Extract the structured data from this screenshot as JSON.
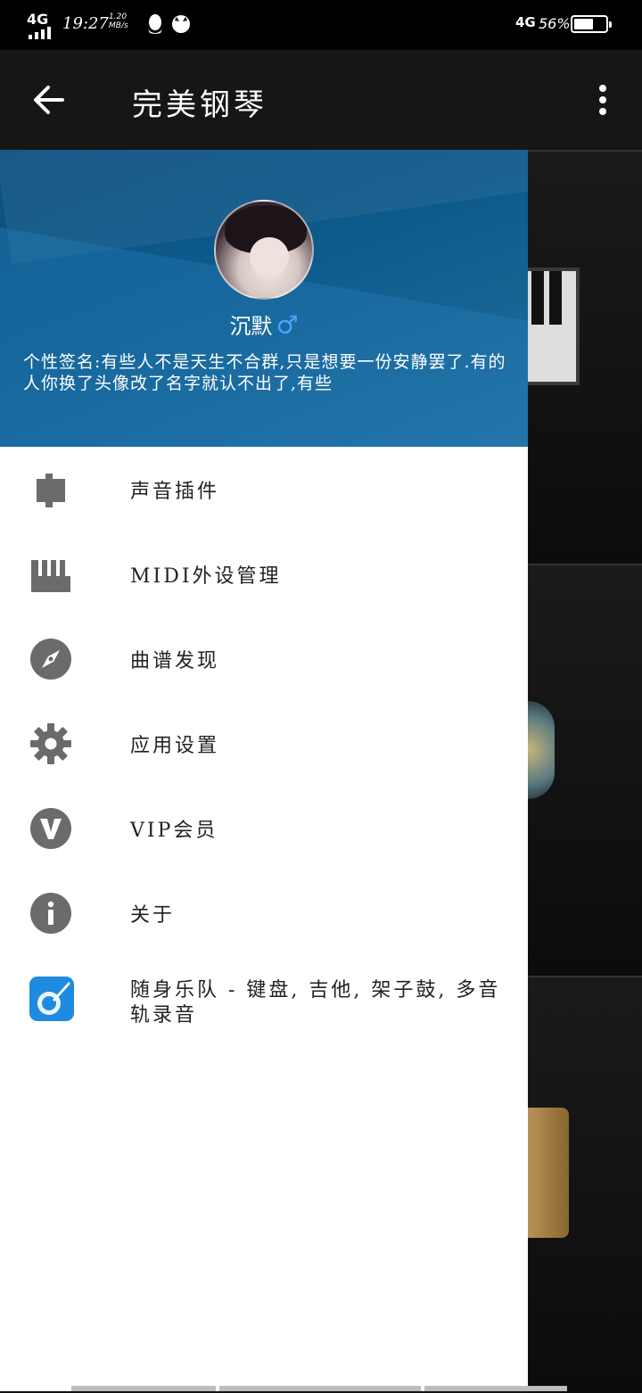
{
  "status_bar": {
    "network_left": "4G",
    "time": "19:27",
    "speed_value": "1.20",
    "speed_unit": "MB/s",
    "network_right": "4G",
    "battery_percent": "56%",
    "battery_level": 0.56
  },
  "app_bar": {
    "title": "完美钢琴"
  },
  "drawer": {
    "username": "沉默",
    "gender_symbol": "♂",
    "signature": "个性签名:有些人不是天生不合群,只是想要一份安静罢了.有的人你换了头像改了名字就认不出了,有些",
    "menu": [
      {
        "label": "声音插件",
        "icon": "puzzle-plugin-icon"
      },
      {
        "label": "MIDI外设管理",
        "icon": "piano-keys-icon"
      },
      {
        "label": "曲谱发现",
        "icon": "compass-icon"
      },
      {
        "label": "应用设置",
        "icon": "gear-icon"
      },
      {
        "label": "VIP会员",
        "icon": "vip-badge-icon"
      },
      {
        "label": "关于",
        "icon": "info-icon"
      },
      {
        "label": "随身乐队 - 键盘, 吉他, 架子鼓, 多音轨录音",
        "icon": "band-app-icon"
      }
    ]
  },
  "colors": {
    "header_blue": "#0d5a8c",
    "icon_gray": "#6b6b6b",
    "app_bar": "#161616",
    "gender_blue": "#4aa3ff"
  }
}
